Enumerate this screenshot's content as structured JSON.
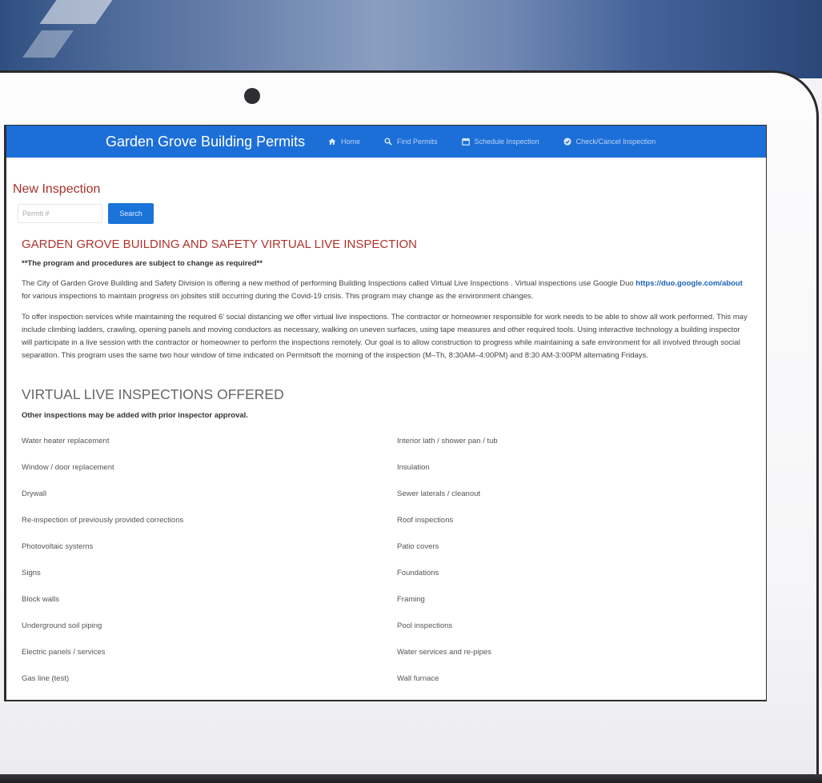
{
  "colors": {
    "navbar_bg": "#1d6fd8",
    "nav_text": "#b9d3f5",
    "accent_red": "#a8322d",
    "link": "#1a62b8",
    "button_bg": "#1a73d9"
  },
  "navbar": {
    "brand": "Garden Grove Building Permits",
    "items": [
      {
        "label": "Home",
        "icon": "home-icon"
      },
      {
        "label": "Find Permits",
        "icon": "search-icon"
      },
      {
        "label": "Schedule Inspection",
        "icon": "calendar-icon"
      },
      {
        "label": "Check/Cancel Inspection",
        "icon": "check-circle-icon"
      }
    ]
  },
  "search": {
    "title": "New Inspection",
    "placeholder": "Permit #",
    "button_label": "Search"
  },
  "notice": {
    "heading": "GARDEN GROVE BUILDING AND SAFETY VIRTUAL LIVE INSPECTION",
    "subject_to_change": "**The program and procedures are subject to change as required**",
    "p1_before_link": "The City of Garden Grove Building and Safety Division is offering a new method of performing Building Inspections called Virtual Live Inspections . Virtual inspections use Google Duo",
    "link": "https://duo.google.com/about",
    "p1_after_link": "for various inspections to maintain progress on jobsites still occurring during the Covid-19 crisis. This program may change as the environment changes.",
    "p2": "To offer inspection services while maintaining the required 6' social distancing we offer virtual live inspections. The contractor or homeowner responsible for work needs to be able to show all work performed. This may include climbing ladders, crawling, opening panels and moving conductors as necessary, walking on uneven surfaces, using tape measures and other required tools. Using interactive technology a building inspector will participate in a live session with the contractor or homeowner to perform the inspections remotely. Our goal is to allow construction to progress while maintaining a safe environment for all involved through social separation. This program uses the same two hour window of time indicated on Permitsoft the morning of the inspection (M–Th, 8:30AM–4:00PM) and 8:30 AM-3:00PM alternating Fridays."
  },
  "offered": {
    "heading": "VIRTUAL LIVE INSPECTIONS OFFERED",
    "note": "Other inspections may be added with prior inspector approval.",
    "left": [
      "Water heater replacement",
      "Window / door replacement",
      "Drywall",
      "Re-inspection of previously provided corrections",
      "Photovoltaic systems",
      "Signs",
      "Block walls",
      "Underground soil piping",
      "Electric panels / services",
      "Gas line (test)"
    ],
    "right": [
      "Interior lath / shower pan / tub",
      "Insulation",
      "Sewer laterals / cleanout",
      "Roof inspections",
      "Patio covers",
      "Foundations",
      "Framing",
      "Pool inspections",
      "Water services and re-pipes",
      "Wall furnace"
    ]
  }
}
